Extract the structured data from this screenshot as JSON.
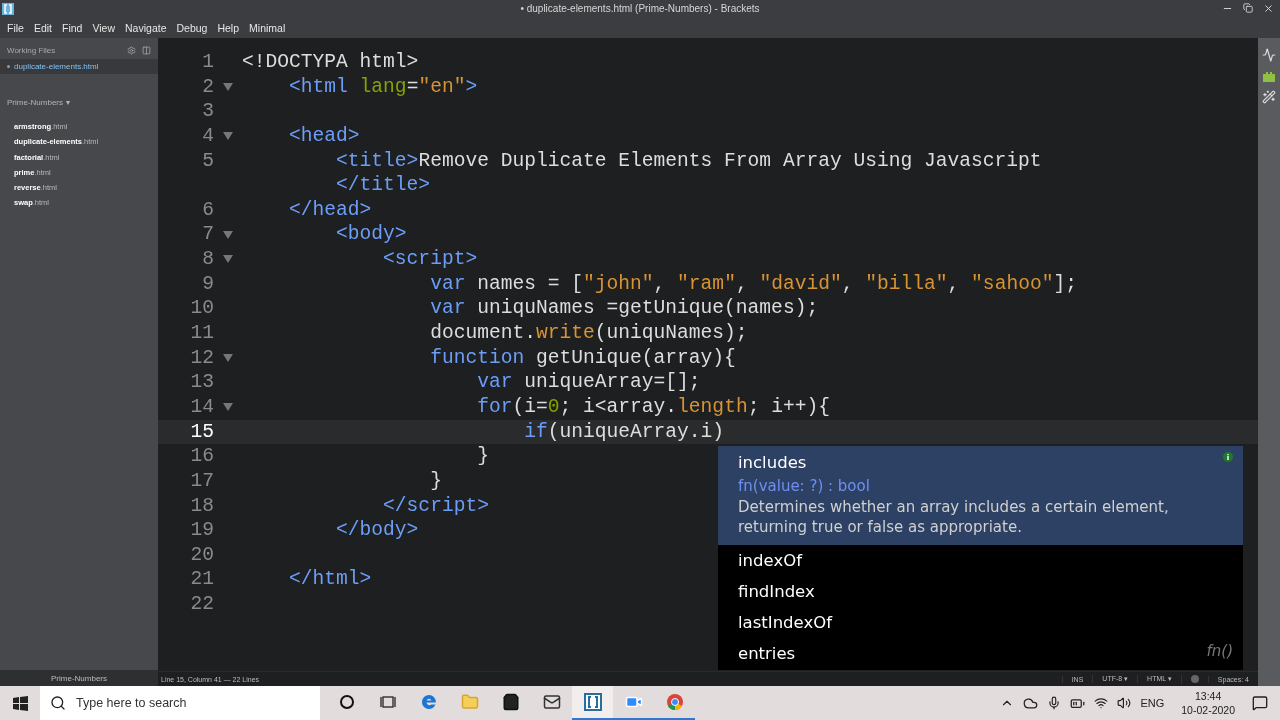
{
  "window": {
    "title": "• duplicate-elements.html (Prime-Numbers) - Brackets"
  },
  "menu": [
    "File",
    "Edit",
    "Find",
    "View",
    "Navigate",
    "Debug",
    "Help",
    "Minimal"
  ],
  "sidebar": {
    "working_files_title": "Working Files",
    "working_files": [
      {
        "name": "duplicate-elements.html",
        "selected": true
      }
    ],
    "project": {
      "title": "Prime-Numbers",
      "caret": "▾"
    },
    "files": [
      {
        "name": "armstrong",
        "ext": ".html"
      },
      {
        "name": "duplicate-elements",
        "ext": ".html"
      },
      {
        "name": "factorial",
        "ext": ".html"
      },
      {
        "name": "prime",
        "ext": ".html"
      },
      {
        "name": "reverse",
        "ext": ".html"
      },
      {
        "name": "swap",
        "ext": ".html"
      }
    ],
    "footer": "Prime-Numbers"
  },
  "editor": {
    "lines": [
      {
        "number": "1",
        "foldable": false,
        "current": false,
        "tokens": [
          {
            "t": "<!DOCTYPA html>",
            "kind": "meta"
          }
        ]
      },
      {
        "number": "2",
        "foldable": true,
        "current": false,
        "tokens": [
          {
            "t": "    <html",
            "kind": "tag"
          },
          {
            "t": " lang",
            "kind": "attr"
          },
          {
            "t": "=",
            "kind": "plain"
          },
          {
            "t": "\"en\"",
            "kind": "str"
          },
          {
            "t": ">",
            "kind": "tag"
          }
        ]
      },
      {
        "number": "3",
        "foldable": false,
        "current": false
      },
      {
        "number": "4",
        "foldable": true,
        "current": false,
        "tokens": [
          {
            "t": "    <head>",
            "kind": "tag"
          }
        ]
      },
      {
        "number": "5",
        "foldable": false,
        "current": false,
        "tokens": [
          {
            "t": "        <title>",
            "kind": "tag"
          },
          {
            "t": "Remove Duplicate Elements From Array Using Javascript",
            "kind": "plain"
          }
        ]
      },
      {
        "foldable": false,
        "current": false,
        "tokens": [
          {
            "t": "        </title>",
            "kind": "tag"
          }
        ]
      },
      {
        "number": "6",
        "foldable": false,
        "current": false,
        "tokens": [
          {
            "t": "    </head>",
            "kind": "tag"
          }
        ]
      },
      {
        "number": "7",
        "foldable": true,
        "current": false,
        "tokens": [
          {
            "t": "        <body>",
            "kind": "tag"
          }
        ]
      },
      {
        "number": "8",
        "foldable": true,
        "current": false,
        "tokens": [
          {
            "t": "            <script>",
            "kind": "tag"
          }
        ]
      },
      {
        "number": "9",
        "foldable": false,
        "current": false,
        "tokens": [
          {
            "t": "                var",
            "kind": "kw"
          },
          {
            "t": " names = [",
            "kind": "plain"
          },
          {
            "t": "\"john\"",
            "kind": "str"
          },
          {
            "t": ", ",
            "kind": "plain"
          },
          {
            "t": "\"ram\"",
            "kind": "str"
          },
          {
            "t": ", ",
            "kind": "plain"
          },
          {
            "t": "\"david\"",
            "kind": "str"
          },
          {
            "t": ", ",
            "kind": "plain"
          },
          {
            "t": "\"billa\"",
            "kind": "str"
          },
          {
            "t": ", ",
            "kind": "plain"
          },
          {
            "t": "\"sahoo\"",
            "kind": "str"
          },
          {
            "t": "];",
            "kind": "plain"
          }
        ]
      },
      {
        "number": "10",
        "foldable": false,
        "current": false,
        "tokens": [
          {
            "t": "                var",
            "kind": "kw"
          },
          {
            "t": " uniquNames =getUnique(names);",
            "kind": "plain"
          }
        ]
      },
      {
        "number": "11",
        "foldable": false,
        "current": false,
        "tokens": [
          {
            "t": "                document.",
            "kind": "plain"
          },
          {
            "t": "write",
            "kind": "prop"
          },
          {
            "t": "(uniquNames);",
            "kind": "plain"
          }
        ]
      },
      {
        "number": "12",
        "foldable": true,
        "current": false,
        "tokens": [
          {
            "t": "                function",
            "kind": "kw"
          },
          {
            "t": " getUnique(array){",
            "kind": "plain"
          }
        ]
      },
      {
        "number": "13",
        "foldable": false,
        "current": false,
        "tokens": [
          {
            "t": "                    var",
            "kind": "kw"
          },
          {
            "t": " uniqueArray=[];",
            "kind": "plain"
          }
        ]
      },
      {
        "number": "14",
        "foldable": true,
        "current": false,
        "tokens": [
          {
            "t": "                    for",
            "kind": "kw"
          },
          {
            "t": "(i=",
            "kind": "plain"
          },
          {
            "t": "0",
            "kind": "num"
          },
          {
            "t": "; i<array.",
            "kind": "plain"
          },
          {
            "t": "length",
            "kind": "prop"
          },
          {
            "t": "; i++){",
            "kind": "plain"
          }
        ]
      },
      {
        "number": "15",
        "foldable": false,
        "current": true,
        "tokens": [
          {
            "t": "                        if",
            "kind": "kw"
          },
          {
            "t": "(uniqueArray.i)",
            "kind": "plain"
          }
        ]
      },
      {
        "number": "16",
        "foldable": false,
        "current": false,
        "tokens": [
          {
            "t": "                    }",
            "kind": "plain"
          }
        ]
      },
      {
        "number": "17",
        "foldable": false,
        "current": false,
        "tokens": [
          {
            "t": "                }",
            "kind": "plain"
          }
        ]
      },
      {
        "number": "18",
        "foldable": false,
        "current": false,
        "tokens": [
          {
            "t": "            </script>",
            "kind": "tag"
          }
        ]
      },
      {
        "number": "19",
        "foldable": false,
        "current": false,
        "tokens": [
          {
            "t": "        </body>",
            "kind": "tag"
          }
        ]
      },
      {
        "number": "20",
        "foldable": false,
        "current": false
      },
      {
        "number": "21",
        "foldable": false,
        "current": false,
        "tokens": [
          {
            "t": "    </html>",
            "kind": "tag"
          }
        ]
      },
      {
        "number": "22",
        "foldable": false,
        "current": false
      }
    ],
    "hints": [
      {
        "name": "includes",
        "selected": true,
        "signature": "fn(value: ?) : bool",
        "description": "Determines whether an array includes a certain element, returning true or false as appropriate."
      },
      {
        "name": "indexOf",
        "selected": false
      },
      {
        "name": "findIndex",
        "selected": false
      },
      {
        "name": "lastIndexOf",
        "selected": false
      },
      {
        "name": "entries",
        "selected": false,
        "type_hint": "fn()"
      }
    ]
  },
  "status_bar": {
    "position": "Line 15, Column 41 — 22 Lines",
    "mode": "INS",
    "encoding": "UTF-8 ▾",
    "language": "HTML ▾",
    "indent": "Spaces: 4"
  },
  "taskbar": {
    "search": {
      "placeholder": "Type here to search"
    },
    "apps": [
      {
        "kind": "cortana",
        "running": false,
        "active": false
      },
      {
        "kind": "taskview",
        "running": false,
        "active": false
      },
      {
        "kind": "edge",
        "running": false,
        "active": false
      },
      {
        "kind": "explorer",
        "running": false,
        "active": false
      },
      {
        "kind": "store",
        "running": false,
        "active": false
      },
      {
        "kind": "mail",
        "running": false,
        "active": false
      },
      {
        "kind": "brackets",
        "running": true,
        "active": true
      },
      {
        "kind": "zoom",
        "running": true,
        "active": false
      },
      {
        "kind": "chrome",
        "running": true,
        "active": false
      }
    ],
    "language": "ENG",
    "time": "13:44",
    "date": "10-02-2020"
  }
}
